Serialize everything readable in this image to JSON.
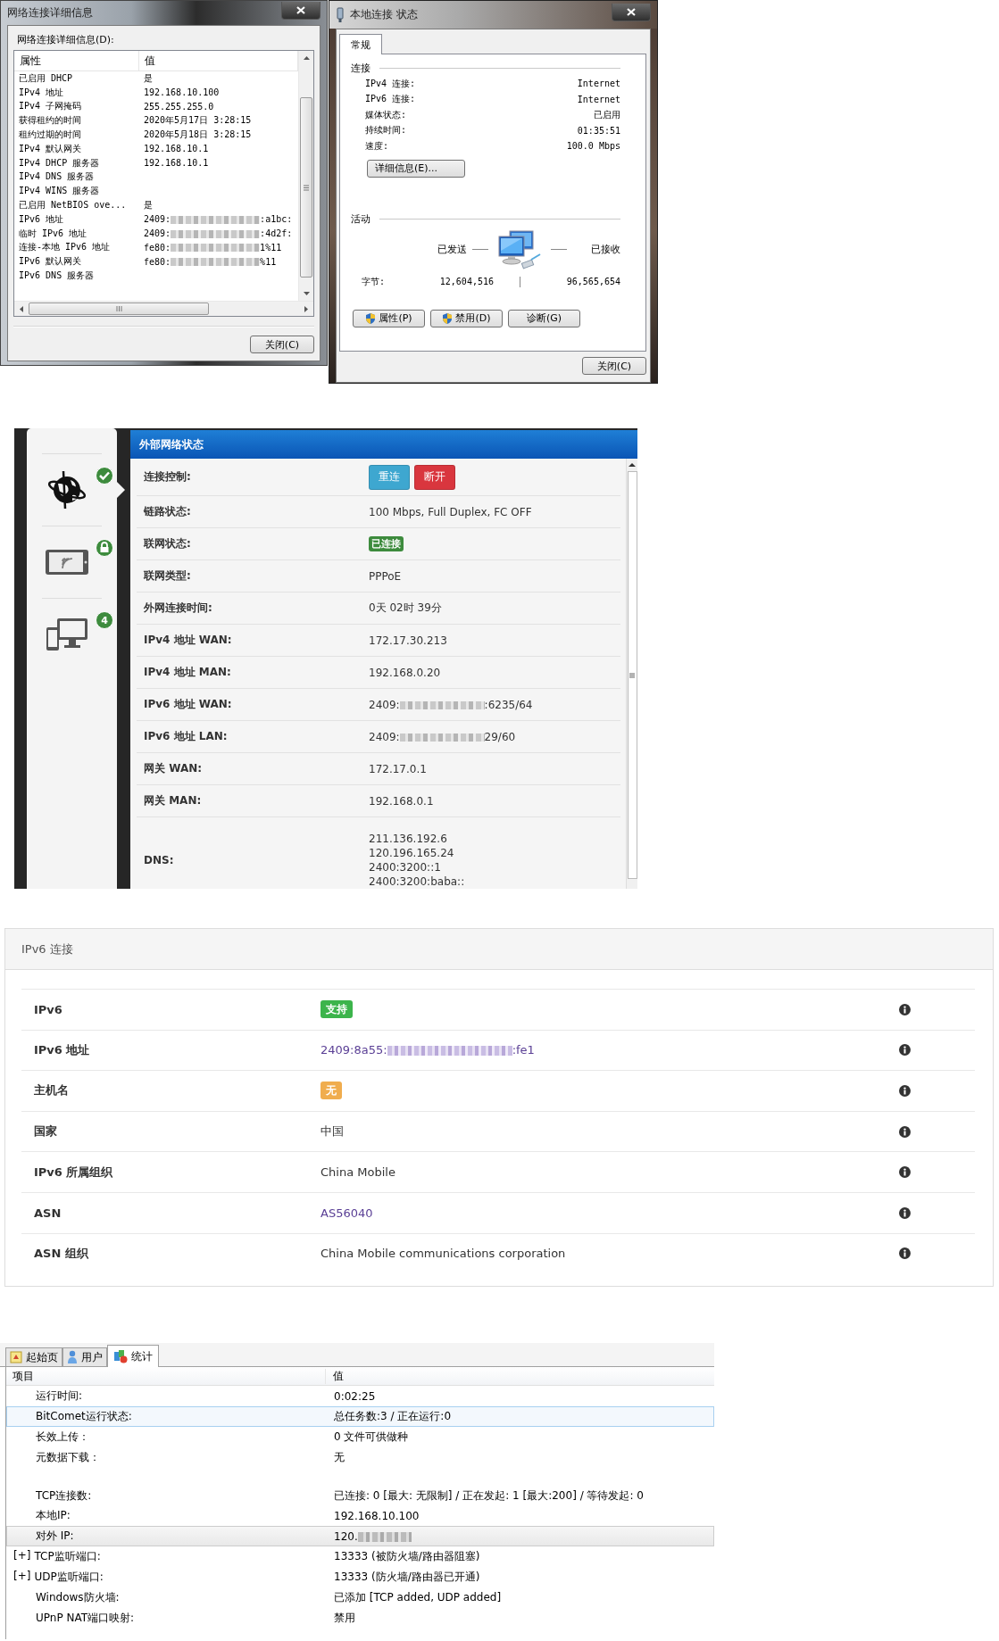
{
  "details_window": {
    "title": "网络连接详细信息",
    "list_label": "网络连接详细信息(D):",
    "columns": [
      "属性",
      "值"
    ],
    "rows": [
      {
        "property": "已启用 DHCP",
        "value": "是",
        "masked": false
      },
      {
        "property": "IPv4 地址",
        "value": "192.168.10.100",
        "masked": false
      },
      {
        "property": "IPv4 子网掩码",
        "value": "255.255.255.0",
        "masked": false
      },
      {
        "property": "获得租约的时间",
        "value": "2020年5月17日 3:28:15",
        "masked": false
      },
      {
        "property": "租约过期的时间",
        "value": "2020年5月18日 3:28:15",
        "masked": false
      },
      {
        "property": "IPv4 默认网关",
        "value": "192.168.10.1",
        "masked": false
      },
      {
        "property": "IPv4 DHCP 服务器",
        "value": "192.168.10.1",
        "masked": false
      },
      {
        "property": "IPv4 DNS 服务器"
      },
      {
        "property": "IPv4 WINS 服务器"
      },
      {
        "property": "已启用 NetBIOS ove...",
        "value": "是",
        "masked": false
      },
      {
        "property": "IPv6 地址",
        "value": "2409:",
        "masked": true,
        "value_tail": ":a1bc:"
      },
      {
        "property": "临时 IPv6 地址",
        "value": "2409:",
        "masked": true,
        "value_tail": ":4d2f:"
      },
      {
        "property": "连接-本地 IPv6 地址",
        "value": "fe80:",
        "masked": true,
        "value_tail": "1%11"
      },
      {
        "property": "IPv6 默认网关",
        "value": "fe80:",
        "masked": true,
        "value_tail": "%11"
      },
      {
        "property": "IPv6 DNS 服务器"
      }
    ],
    "close_button": "关闭(C)"
  },
  "status_window": {
    "title": "本地连接 状态",
    "tabs": [
      {
        "label": "常规",
        "selected": true
      }
    ],
    "connection_heading": "连接",
    "connection_rows": [
      {
        "label": "IPv4 连接:",
        "value": "Internet"
      },
      {
        "label": "IPv6 连接:",
        "value": "Internet"
      },
      {
        "label": "媒体状态:",
        "value": "已启用"
      },
      {
        "label": "持续时间:",
        "value": "01:35:51"
      },
      {
        "label": "速度:",
        "value": "100.0 Mbps"
      }
    ],
    "details_button": "详细信息(E)...",
    "activity_heading": "活动",
    "sent_label": "已发送",
    "received_label": "已接收",
    "bytes_label": "字节:",
    "bytes_sent": "12,604,516",
    "bytes_received": "96,565,654",
    "buttons": [
      {
        "label": "属性(P)",
        "shield": true
      },
      {
        "label": "禁用(D)",
        "shield": true
      },
      {
        "label": "诊断(G)",
        "shield": false
      }
    ],
    "close_button": "关闭(C)"
  },
  "router": {
    "sidebar": [
      {
        "kind": "internet",
        "selected": true
      },
      {
        "kind": "wireless",
        "selected": false
      },
      {
        "kind": "devices",
        "badge": "4",
        "selected": false
      }
    ],
    "title": "外部网络状态",
    "rows": [
      {
        "label": "连接控制:",
        "kind": "buttons",
        "buttons": [
          {
            "label": "重连",
            "color": "#3ea7d0"
          },
          {
            "label": "断开",
            "color": "#d9363e"
          }
        ]
      },
      {
        "label": "链路状态:",
        "kind": "text",
        "value": "100 Mbps, Full Duplex, FC OFF",
        "masked": false
      },
      {
        "label": "联网状态:",
        "kind": "status",
        "value": "已连接",
        "color": "#3d8b3d"
      },
      {
        "label": "联网类型:",
        "kind": "text",
        "value": "PPPoE",
        "masked": false
      },
      {
        "label": "外网连接时间:",
        "kind": "text",
        "value": "0天 02时 39分",
        "masked": false
      },
      {
        "label": "IPv4 地址 WAN:",
        "kind": "text",
        "value": "172.17.30.213",
        "masked": false
      },
      {
        "label": "IPv4 地址 MAN:",
        "kind": "text",
        "value": "192.168.0.20",
        "masked": false
      },
      {
        "label": "IPv6 地址 WAN:",
        "kind": "text",
        "value": "2409:",
        "masked": true,
        "value_tail": ":6235/64"
      },
      {
        "label": "IPv6 地址 LAN:",
        "kind": "text",
        "value": "2409:",
        "masked": true,
        "value_tail": "29/60"
      },
      {
        "label": "网关 WAN:",
        "kind": "text",
        "value": "172.17.0.1",
        "masked": false
      },
      {
        "label": "网关 MAN:",
        "kind": "text",
        "value": "192.168.0.1",
        "masked": false
      },
      {
        "label": "DNS:",
        "kind": "lines",
        "lines": [
          "211.136.192.6",
          "120.196.165.24",
          "2400:3200::1",
          "2400:3200:baba::"
        ]
      }
    ]
  },
  "ipv6": {
    "title": "IPv6 连接",
    "rows": [
      {
        "label": "IPv6",
        "kind": "badge",
        "value": "支持",
        "color": "#3cb44b"
      },
      {
        "label": "IPv6 地址",
        "kind": "link",
        "value": "2409:8a55:",
        "masked": true,
        "value_tail": ":fe1"
      },
      {
        "label": "主机名",
        "kind": "badge",
        "value": "无",
        "color": "#f0ad4e"
      },
      {
        "label": "国家",
        "kind": "text",
        "value": "中国"
      },
      {
        "label": "IPv6 所属组织",
        "kind": "text",
        "value": "China Mobile"
      },
      {
        "label": "ASN",
        "kind": "link",
        "value": "AS56040",
        "masked": false
      },
      {
        "label": "ASN 组织",
        "kind": "text",
        "value": "China Mobile communications corporation"
      }
    ]
  },
  "bitcomet": {
    "tabs": [
      {
        "label": "起始页",
        "kind": "home",
        "selected": false
      },
      {
        "label": "用户",
        "kind": "user",
        "selected": false
      },
      {
        "label": "统计",
        "kind": "stats",
        "selected": true
      }
    ],
    "columns": [
      "项目",
      "值"
    ],
    "rows": [
      {
        "item": "运行时间:",
        "value": "0:02:25",
        "masked": false,
        "selected": false,
        "hovered": false,
        "gap_before": false
      },
      {
        "item": "BitComet运行状态:",
        "value": "总任务数:3 / 正在运行:0",
        "masked": false,
        "selected": true,
        "hovered": false,
        "gap_before": false
      },
      {
        "item": "长效上传：",
        "value": "0 文件可供做种",
        "masked": false,
        "selected": false,
        "hovered": false,
        "gap_before": false
      },
      {
        "item": "元数据下载：",
        "value": "无",
        "masked": false,
        "selected": false,
        "hovered": false,
        "gap_before": false
      },
      {
        "item": "TCP连接数:",
        "value": "已连接: 0 [最大: 无限制] / 正在发起: 1 [最大:200] / 等待发起: 0",
        "masked": false,
        "selected": false,
        "hovered": false,
        "gap_before": true
      },
      {
        "item": "本地IP:",
        "value": "192.168.10.100",
        "masked": false,
        "selected": false,
        "hovered": false,
        "gap_before": false
      },
      {
        "item": "对外 IP:",
        "value": "120.",
        "masked": true,
        "selected": false,
        "hovered": true,
        "gap_before": false
      },
      {
        "item": "TCP监听端口:",
        "expander": "[+]",
        "value": "13333 (被防火墙/路由器阻塞)",
        "masked": false,
        "selected": false,
        "hovered": false,
        "gap_before": false
      },
      {
        "item": "UDP监听端口:",
        "expander": "[+]",
        "value": "13333 (防火墙/路由器已开通)",
        "masked": false,
        "selected": false,
        "hovered": false,
        "gap_before": false
      },
      {
        "item": "Windows防火墙:",
        "value": "已添加 [TCP added, UDP added]",
        "masked": false,
        "selected": false,
        "hovered": false,
        "gap_before": false
      },
      {
        "item": "UPnP NAT端口映射:",
        "value": "禁用",
        "masked": false,
        "selected": false,
        "hovered": false,
        "gap_before": false
      }
    ]
  }
}
